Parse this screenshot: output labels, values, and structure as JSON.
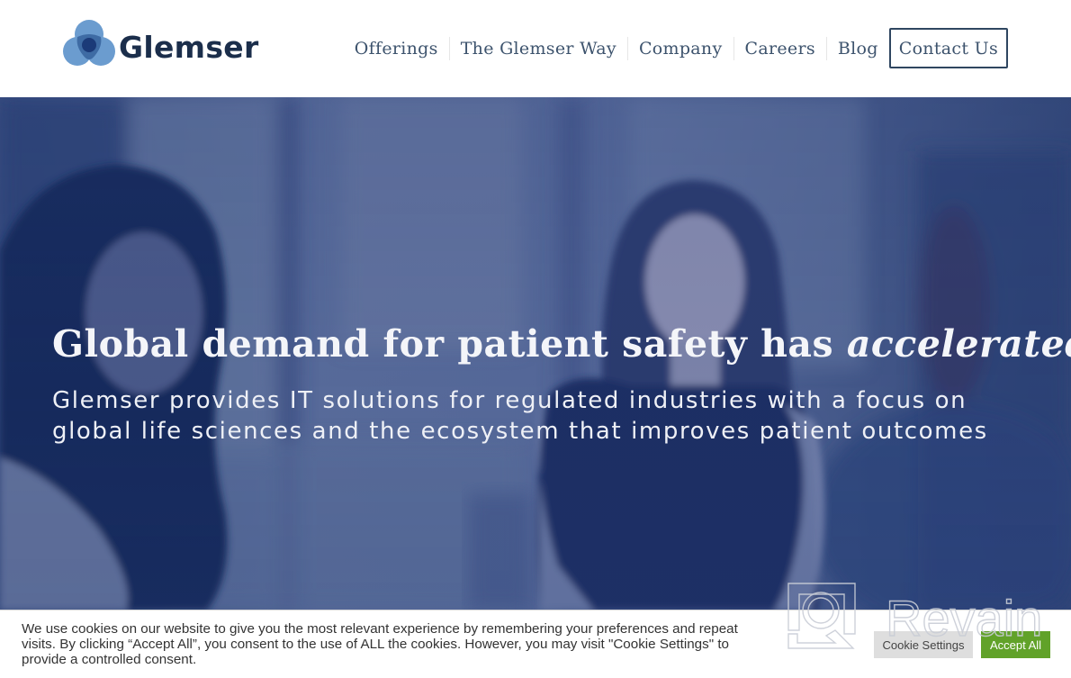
{
  "header": {
    "logo_text": "Glemser",
    "nav": [
      {
        "label": "Offerings"
      },
      {
        "label": "The Glemser Way"
      },
      {
        "label": "Company"
      },
      {
        "label": "Careers"
      },
      {
        "label": "Blog"
      }
    ],
    "contact_label": "Contact Us"
  },
  "hero": {
    "title_main": "Global demand for patient safety has ",
    "title_emphasis": "accelerated",
    "subtitle": "Glemser provides IT solutions for regulated industries with a focus on global life sciences and the ecosystem that improves patient outcomes"
  },
  "cookie": {
    "message": "We use cookies on our website to give you the most relevant experience by remembering your preferences and repeat visits. By clicking “Accept All”, you consent to the use of ALL the cookies. However, you may visit \"Cookie Settings\" to provide a controlled consent.",
    "settings_label": "Cookie Settings",
    "accept_label": "Accept All"
  },
  "watermark": {
    "text": "Revain"
  },
  "colors": {
    "brand_navy": "#1b2e4b",
    "nav_text": "#3d536d",
    "hero_tint": "#4a5f91",
    "accept_green": "#61a229",
    "settings_gray": "#dedede"
  }
}
